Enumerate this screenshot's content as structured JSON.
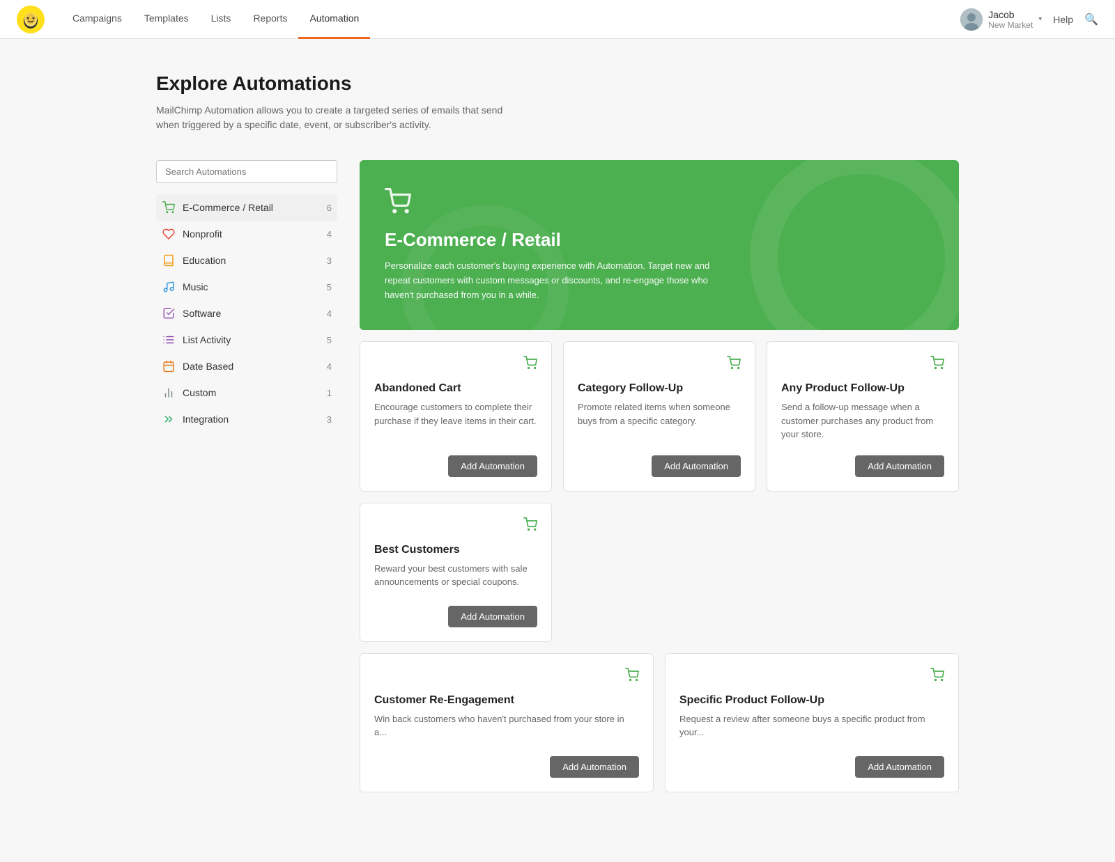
{
  "nav": {
    "links": [
      {
        "label": "Campaigns",
        "active": false
      },
      {
        "label": "Templates",
        "active": false
      },
      {
        "label": "Lists",
        "active": false
      },
      {
        "label": "Reports",
        "active": false
      },
      {
        "label": "Automation",
        "active": true
      }
    ],
    "user": {
      "name": "Jacob",
      "company": "New Market"
    },
    "help_label": "Help"
  },
  "page": {
    "title": "Explore Automations",
    "description": "MailChimp Automation allows you to create a targeted series of emails that send when triggered by a specific date, event, or subscriber's activity."
  },
  "sidebar": {
    "search_placeholder": "Search Automations",
    "items": [
      {
        "id": "ecommerce",
        "label": "E-Commerce / Retail",
        "count": "6",
        "icon": "🛒",
        "active": true
      },
      {
        "id": "nonprofit",
        "label": "Nonprofit",
        "count": "4",
        "icon": "♥",
        "active": false
      },
      {
        "id": "education",
        "label": "Education",
        "count": "3",
        "icon": "📖",
        "active": false
      },
      {
        "id": "music",
        "label": "Music",
        "count": "5",
        "icon": "🎵",
        "active": false
      },
      {
        "id": "software",
        "label": "Software",
        "count": "4",
        "icon": "🖱",
        "active": false
      },
      {
        "id": "list-activity",
        "label": "List Activity",
        "count": "5",
        "icon": "≡",
        "active": false
      },
      {
        "id": "date-based",
        "label": "Date Based",
        "count": "4",
        "icon": "📅",
        "active": false
      },
      {
        "id": "custom",
        "label": "Custom",
        "count": "1",
        "icon": "⚙",
        "active": false
      },
      {
        "id": "integration",
        "label": "Integration",
        "count": "3",
        "icon": "»",
        "active": false
      }
    ]
  },
  "hero": {
    "title": "E-Commerce / Retail",
    "description": "Personalize each customer's buying experience with Automation. Target new and repeat customers with custom messages or discounts, and re-engage those who haven't purchased from you in a while.",
    "icon": "cart"
  },
  "cards_row1": [
    {
      "title": "Abandoned Cart",
      "description": "Encourage customers to complete their purchase if they leave items in their cart.",
      "add_label": "Add Automation",
      "icon": "cart"
    },
    {
      "title": "Category Follow-Up",
      "description": "Promote related items when someone buys from a specific category.",
      "add_label": "Add Automation",
      "icon": "cart"
    },
    {
      "title": "Any Product Follow-Up",
      "description": "Send a follow-up message when a customer purchases any product from your store.",
      "add_label": "Add Automation",
      "icon": "cart"
    }
  ],
  "cards_row2": [
    {
      "title": "Best Customers",
      "description": "Reward your best customers with sale announcements or special coupons.",
      "add_label": "Add Automation",
      "icon": "cart"
    }
  ],
  "cards_row3": [
    {
      "title": "Customer Re-Engagement",
      "description": "Win back customers who haven't purchased from your store in a...",
      "add_label": "Add Automation",
      "icon": "cart"
    },
    {
      "title": "Specific Product Follow-Up",
      "description": "Request a review after someone buys a specific product from your...",
      "add_label": "Add Automation",
      "icon": "cart"
    }
  ]
}
